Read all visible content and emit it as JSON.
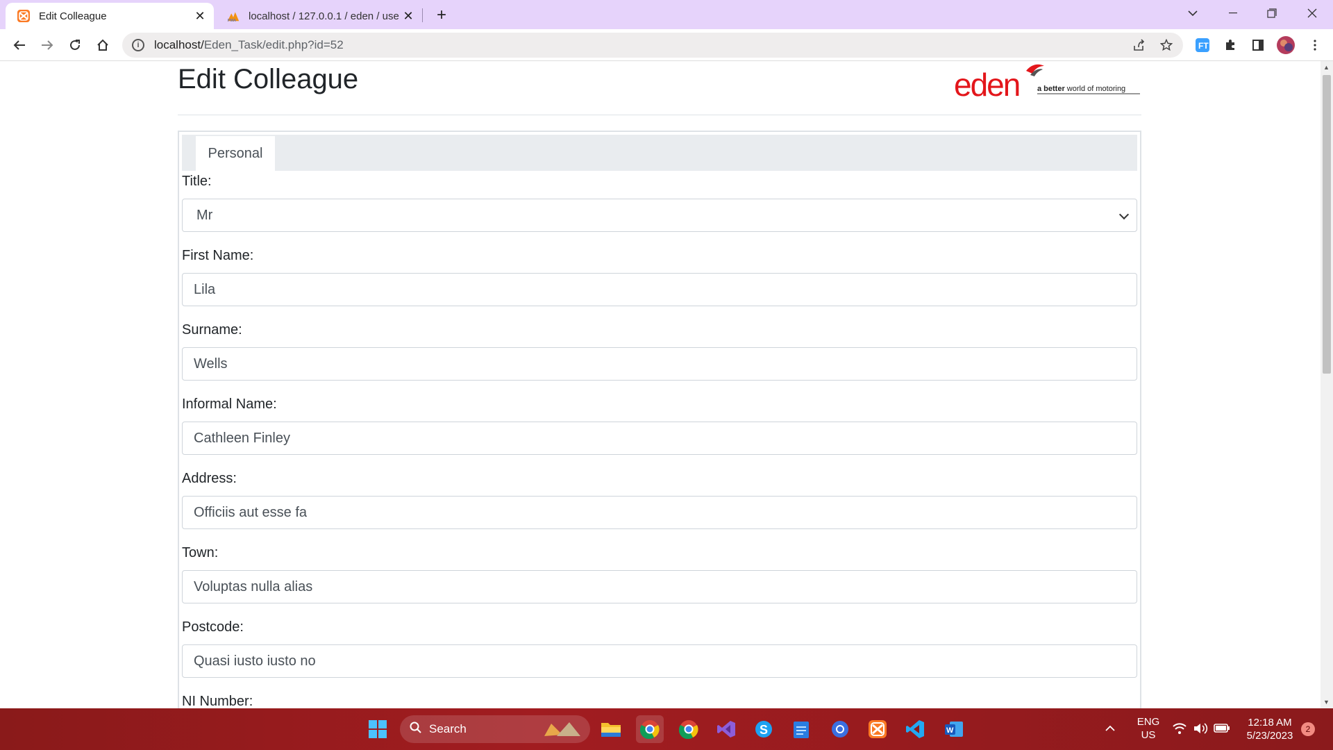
{
  "browser": {
    "tabs": [
      {
        "title": "Edit Colleague",
        "active": true,
        "favicon": "xampp-icon"
      },
      {
        "title": "localhost / 127.0.0.1 / eden / use",
        "active": false,
        "favicon": "phpmyadmin-icon"
      }
    ],
    "address": {
      "host": "localhost/",
      "path": "Eden_Task/edit.php?id=52"
    }
  },
  "page": {
    "title": "Edit Colleague",
    "logo": {
      "wordmark": "eden",
      "tagline_bold": "a better",
      "tagline": " world of motoring"
    },
    "tabs": [
      {
        "label": "Personal"
      }
    ],
    "form": {
      "title": {
        "label": "Title:",
        "value": "Mr"
      },
      "first_name": {
        "label": "First Name:",
        "value": "Lila"
      },
      "surname": {
        "label": "Surname:",
        "value": "Wells"
      },
      "informal_name": {
        "label": "Informal Name:",
        "value": "Cathleen Finley"
      },
      "address": {
        "label": "Address:",
        "value": "Officiis aut esse fa"
      },
      "town": {
        "label": "Town:",
        "value": "Voluptas nulla alias"
      },
      "postcode": {
        "label": "Postcode:",
        "value": "Quasi iusto iusto no"
      },
      "ni_number": {
        "label": "NI Number:"
      }
    }
  },
  "taskbar": {
    "search_label": "Search",
    "lang": {
      "line1": "ENG",
      "line2": "US"
    },
    "time": "12:18 AM",
    "date": "5/23/2023",
    "notification_count": "2"
  },
  "colors": {
    "tabbar": "#e6d3fb",
    "taskbar": "#a11c20",
    "logo_red": "#e3161b"
  }
}
